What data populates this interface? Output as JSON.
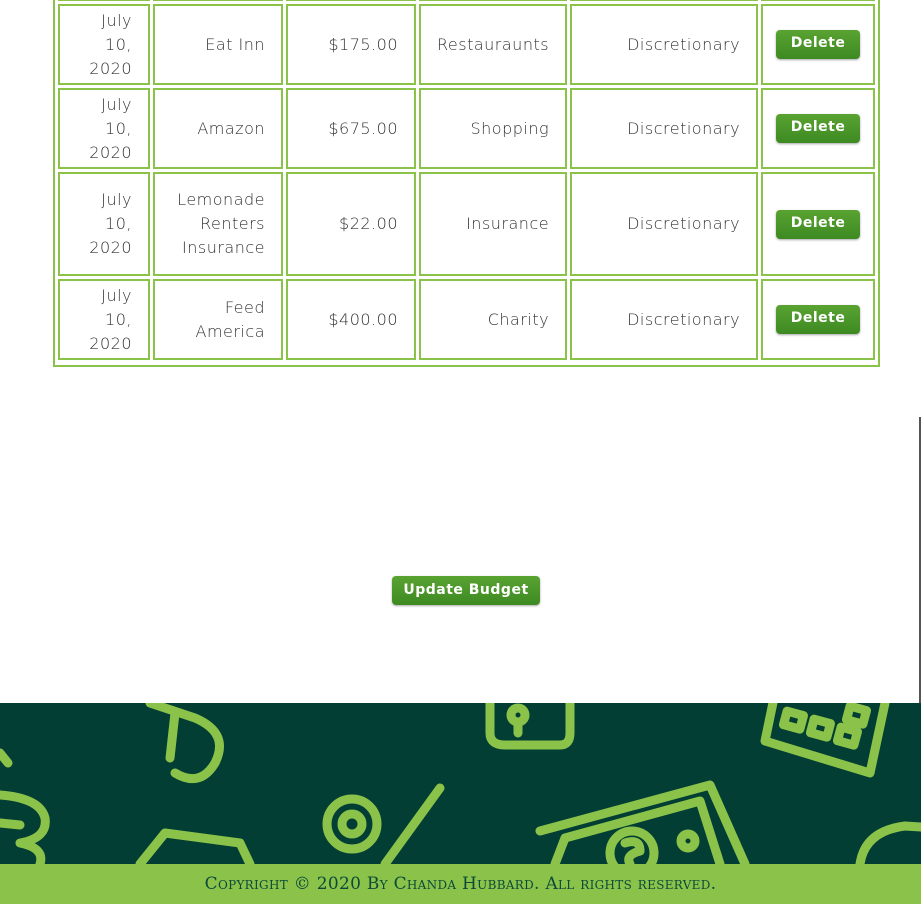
{
  "expenses": {
    "rows": [
      {
        "date": "July 10, 2020",
        "payee": "Eat Inn",
        "amount": "$175.00",
        "category": "Restauraunts",
        "type": "Discretionary",
        "action": "Delete"
      },
      {
        "date": "July 10, 2020",
        "payee": "Amazon",
        "amount": "$675.00",
        "category": "Shopping",
        "type": "Discretionary",
        "action": "Delete"
      },
      {
        "date": "July 10, 2020",
        "payee": "Lemonade Renters Insurance",
        "amount": "$22.00",
        "category": "Insurance",
        "type": "Discretionary",
        "action": "Delete"
      },
      {
        "date": "July 10, 2020",
        "payee": "Feed America",
        "amount": "$400.00",
        "category": "Charity",
        "type": "Discretionary",
        "action": "Delete"
      }
    ]
  },
  "actions": {
    "update_budget_label": "Update Budget"
  },
  "footer": {
    "copyright": "Copyright © 2020 By Chanda Hubbard. All rights reserved.",
    "colors": {
      "art_bg": "#033e34",
      "accent": "#8bc34a",
      "icon_line": "#8bc34a"
    },
    "decor_icons": [
      "money-bill-icon",
      "dollar-icon",
      "percent-icon",
      "calculator-icon",
      "pie-chart-icon"
    ]
  }
}
